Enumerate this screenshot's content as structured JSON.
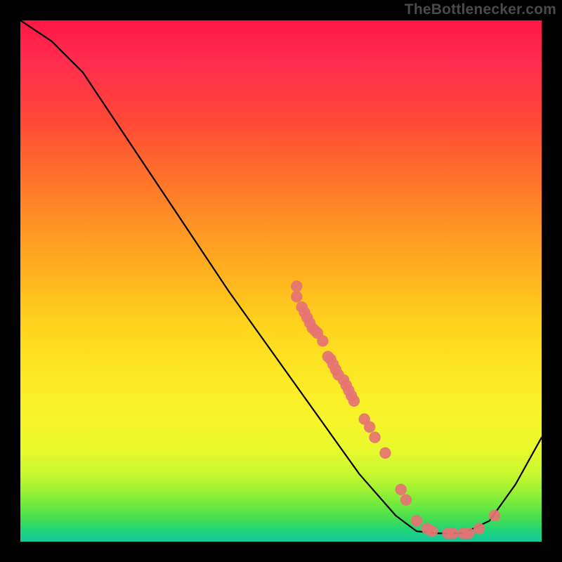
{
  "watermark": "TheBottlenecker.com",
  "chart_data": {
    "type": "line",
    "title": "",
    "xlabel": "",
    "ylabel": "",
    "xlim": [
      0,
      100
    ],
    "ylim": [
      0,
      100
    ],
    "curve": [
      {
        "x": 0,
        "y": 100
      },
      {
        "x": 6,
        "y": 96
      },
      {
        "x": 12,
        "y": 90
      },
      {
        "x": 16,
        "y": 84
      },
      {
        "x": 40,
        "y": 48
      },
      {
        "x": 55,
        "y": 27
      },
      {
        "x": 65,
        "y": 13
      },
      {
        "x": 72,
        "y": 5
      },
      {
        "x": 76,
        "y": 2
      },
      {
        "x": 80,
        "y": 1.6
      },
      {
        "x": 85,
        "y": 1.6
      },
      {
        "x": 90,
        "y": 4
      },
      {
        "x": 95,
        "y": 11
      },
      {
        "x": 100,
        "y": 20
      }
    ],
    "markers": [
      {
        "x": 53,
        "y": 49
      },
      {
        "x": 53,
        "y": 47
      },
      {
        "x": 54,
        "y": 45
      },
      {
        "x": 54.5,
        "y": 44
      },
      {
        "x": 55,
        "y": 43
      },
      {
        "x": 55.5,
        "y": 42
      },
      {
        "x": 56,
        "y": 41
      },
      {
        "x": 56.5,
        "y": 40.5
      },
      {
        "x": 57,
        "y": 40
      },
      {
        "x": 58,
        "y": 38.5
      },
      {
        "x": 59,
        "y": 35.5
      },
      {
        "x": 59.5,
        "y": 35
      },
      {
        "x": 60,
        "y": 34
      },
      {
        "x": 60.5,
        "y": 33
      },
      {
        "x": 61,
        "y": 32
      },
      {
        "x": 62,
        "y": 31
      },
      {
        "x": 62.5,
        "y": 30
      },
      {
        "x": 63,
        "y": 29
      },
      {
        "x": 63.5,
        "y": 28
      },
      {
        "x": 64,
        "y": 27
      },
      {
        "x": 66,
        "y": 23.5
      },
      {
        "x": 67,
        "y": 22
      },
      {
        "x": 68,
        "y": 20
      },
      {
        "x": 70,
        "y": 17
      },
      {
        "x": 73,
        "y": 10
      },
      {
        "x": 74,
        "y": 8
      },
      {
        "x": 76,
        "y": 4
      },
      {
        "x": 78,
        "y": 2.5
      },
      {
        "x": 79,
        "y": 2
      },
      {
        "x": 82,
        "y": 1.6
      },
      {
        "x": 83,
        "y": 1.6
      },
      {
        "x": 85,
        "y": 1.6
      },
      {
        "x": 86,
        "y": 1.6
      },
      {
        "x": 88,
        "y": 2.5
      },
      {
        "x": 91,
        "y": 5
      }
    ],
    "marker_color": "#e57373"
  }
}
